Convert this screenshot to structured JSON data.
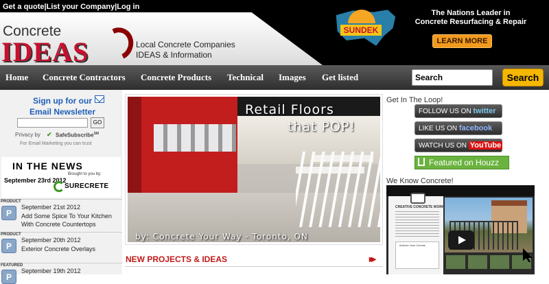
{
  "top_links": {
    "quote": "Get a quote",
    "sep1": " | ",
    "list": "List your Company",
    "sep2": "  | ",
    "login": "Log in"
  },
  "logo": {
    "concrete": "Concrete",
    "ideas": "IDEAS"
  },
  "tagline": {
    "line1": "Local Concrete Companies",
    "line2": "IDEAS & Information"
  },
  "ad": {
    "brand": "SUNDEK",
    "headline_line1": "The Nations Leader in",
    "headline_line2": "Concrete Resurfacing & Repair",
    "cta": "LEARN MORE",
    "colors": {
      "map": "#2a7fa8",
      "cta": "#f29a1d"
    }
  },
  "nav": {
    "items": [
      "Home",
      "Concrete Contractors",
      "Concrete Products",
      "Technical",
      "Images",
      "Get listed"
    ],
    "search_placeholder": "Search",
    "search_button": "Search",
    "colors": {
      "search_button": "#f5b700"
    }
  },
  "newsletter": {
    "title_line1": "Sign up for our",
    "title_line2": "Email Newsletter",
    "go": "GO",
    "privacy": "Privacy by",
    "safesub": "SafeSubscribe",
    "safesub_mark": "SM",
    "email_marketing": "For Email Marketing you can trust"
  },
  "news": {
    "title": "IN THE NEWS",
    "brought": "Brought to you by:",
    "date": "September 23rd 2012",
    "sponsor": "SURECRETE"
  },
  "posts": [
    {
      "tag": "PRODUCT",
      "icon": "P",
      "date": "September 21st 2012",
      "title": "Add Some Spice To Your Kitchen With Concrete Countertops"
    },
    {
      "tag": "PRODUCT",
      "icon": "P",
      "date": "September 20th 2012",
      "title": "Exterior Concrete Overlays"
    },
    {
      "tag": "FEATURED",
      "icon": "P",
      "date": "September 19th 2012",
      "title": ""
    }
  ],
  "slider": {
    "title_line1": "Retail Floors",
    "title_line2": "that POP!",
    "caption": "by:  Concrete Your Way - Toronto, ON"
  },
  "new_projects": {
    "title": "NEW PROJECTS & IDEAS",
    "arrows": "▸▸"
  },
  "sidebar": {
    "loop_title": "Get In The Loop!",
    "twitter_prefix": "FOLLOW US ON",
    "twitter_brand": "twitter",
    "facebook_prefix": "LIKE US ON",
    "facebook_brand": "facebook",
    "youtube_prefix": "WATCH US ON",
    "youtube_brand": "YouTube",
    "houzz": "Featured on Houzz",
    "know_title": "We Know Concrete!",
    "video_company": "CREATIVE CONCRETE WORKS",
    "video_card": "Antonio Jose Cuevas"
  }
}
